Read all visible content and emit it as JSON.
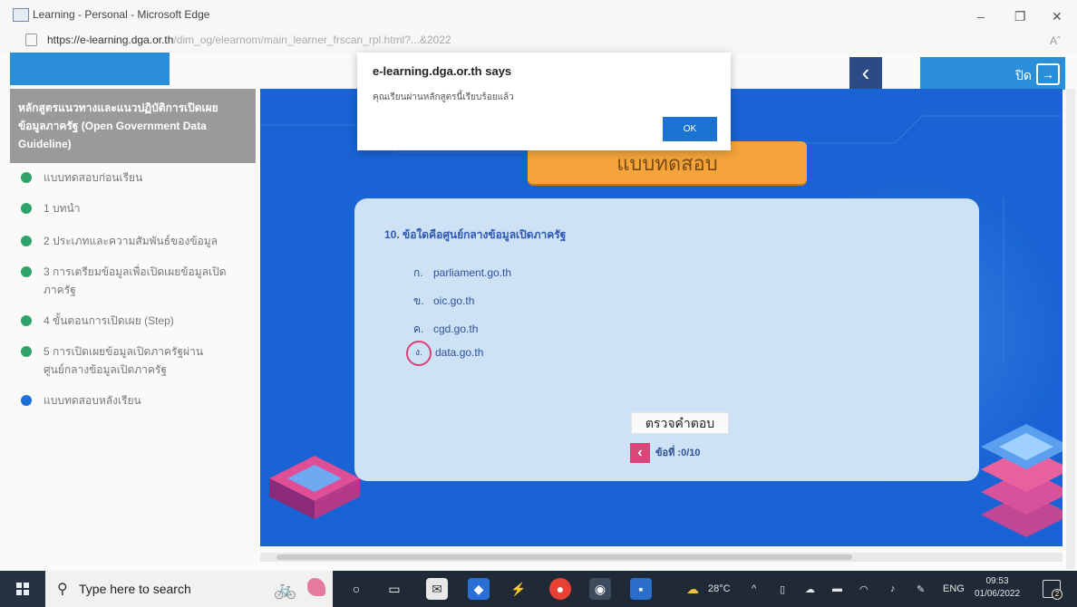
{
  "browser": {
    "title": "Learning - Personal - Microsoft Edge",
    "url_domain": "https://e-learning.dga.or.th",
    "url_path": "/dim_og/elearnom/main_learner_frscan_rpl.html?...&2022"
  },
  "window_controls": {
    "minimize": "–",
    "restore": "❐",
    "close": "✕"
  },
  "header": {
    "back": "‹",
    "exit_label": "ปิด",
    "exit_icon": "→"
  },
  "sidebar": {
    "title": "หลักสูตรแนวทางและแนวปฏิบัติการเปิดเผยข้อมูลภาครัฐ (Open Government Data Guideline)",
    "items": [
      {
        "label": "แบบทดสอบก่อนเรียน",
        "status_color": "#2fa36a"
      },
      {
        "label": "1 บทนำ",
        "status_color": "#2fa36a"
      },
      {
        "label": "2 ประเภทและความสัมพันธ์ของข้อมูล",
        "status_color": "#2fa36a"
      },
      {
        "label": "3 การเตรียมข้อมูลเพื่อเปิดเผยข้อมูลเปิดภาครัฐ",
        "status_color": "#2fa36a"
      },
      {
        "label": "4 ขั้นตอนการเปิดเผย (Step)",
        "status_color": "#2fa36a"
      },
      {
        "label": "5 การเปิดเผยข้อมูลเปิดภาครัฐผ่านศูนย์กลางข้อมูลเปิดภาครัฐ",
        "status_color": "#2fa36a"
      },
      {
        "label": "แบบทดสอบหลังเรียน",
        "status_color": "#1f6fd6"
      }
    ]
  },
  "quiz": {
    "banner": "แบบทดสอบ",
    "question": "10. ข้อใดคือศูนย์กลางข้อมูลเปิดภาครัฐ",
    "options": [
      {
        "mark": "ก.",
        "text": "parliament.go.th"
      },
      {
        "mark": "ข.",
        "text": "oic.go.th"
      },
      {
        "mark": "ค.",
        "text": "cgd.go.th"
      },
      {
        "mark": "ง.",
        "text": "data.go.th"
      }
    ],
    "check_button": "ตรวจคำตอบ",
    "prev": "‹",
    "counter": "ข้อที่ :0/10"
  },
  "dialog": {
    "title": "e-learning.dga.or.th says",
    "message": "คุณเรียนผ่านหลักสูตรนี้เรียบร้อยแล้ว",
    "ok": "OK"
  },
  "taskbar": {
    "search_placeholder": "Type here to search",
    "weather": "28°C",
    "language": "ENG",
    "time": "09:53",
    "date": "01/06/2022",
    "notification_count": "2"
  }
}
